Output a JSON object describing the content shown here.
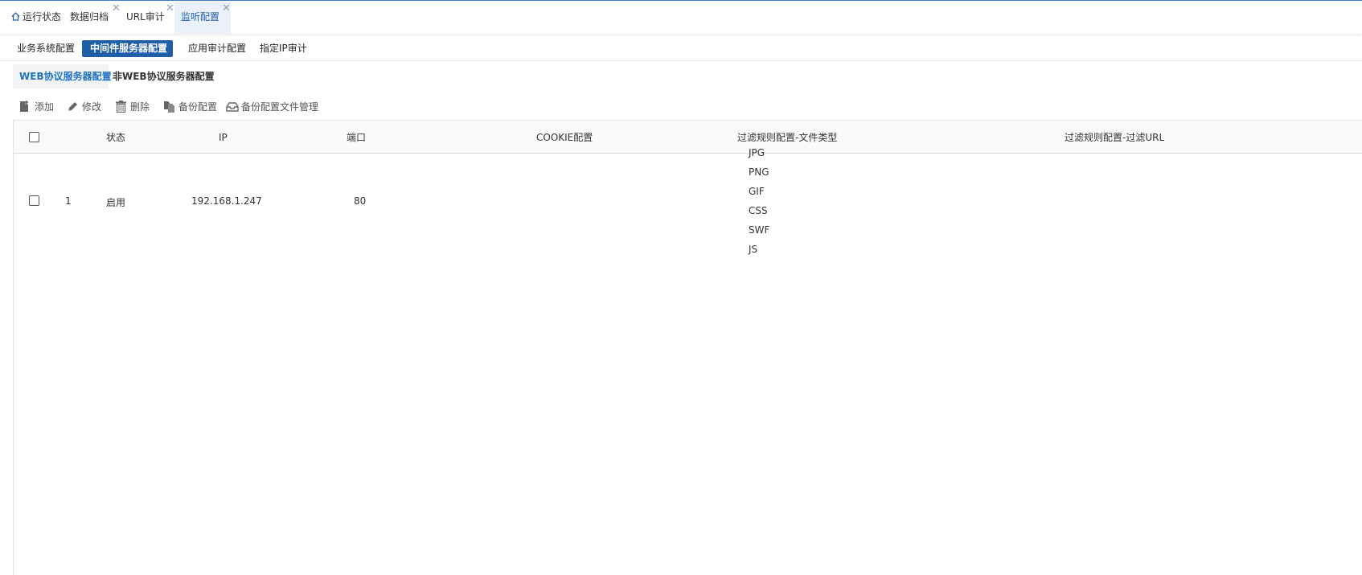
{
  "top_tabs": [
    {
      "label": "运行状态",
      "icon": "home-icon",
      "closable": false
    },
    {
      "label": "数据归档",
      "closable": true
    },
    {
      "label": "URL审计",
      "closable": true
    },
    {
      "label": "监听配置",
      "closable": true,
      "active": true
    }
  ],
  "close_glyph": "✕",
  "sub_tabs": [
    {
      "label": "业务系统配置"
    },
    {
      "label": "中间件服务器配置",
      "active": true
    },
    {
      "label": "应用审计配置"
    },
    {
      "label": "指定IP审计"
    }
  ],
  "third_tabs": [
    {
      "label": "WEB协议服务器配置",
      "active": true
    },
    {
      "label": "非WEB协议服务器配置"
    }
  ],
  "toolbar": {
    "add": "添加",
    "edit": "修改",
    "delete": "删除",
    "backup": "备份配置",
    "backup_manage": "备份配置文件管理"
  },
  "table": {
    "headers": {
      "status": "状态",
      "ip": "IP",
      "port": "端口",
      "cookie": "COOKIE配置",
      "filter_type": "过滤规则配置-文件类型",
      "filter_url": "过滤规则配置-过滤URL"
    },
    "rows": [
      {
        "index": "1",
        "status": "启用",
        "ip": "192.168.1.247",
        "port": "80",
        "cookie": "",
        "file_types": [
          "JPG",
          "PNG",
          "GIF",
          "CSS",
          "SWF",
          "JS"
        ],
        "filter_url": ""
      }
    ]
  },
  "colors": {
    "accent": "#1f5fa8",
    "link_blue": "#1f72c0"
  }
}
